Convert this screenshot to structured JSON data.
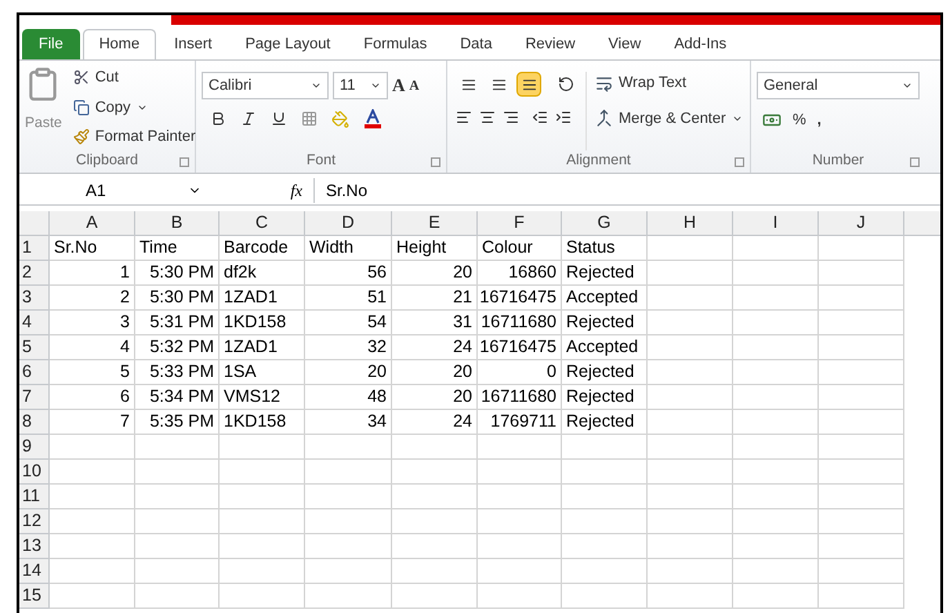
{
  "tabs": [
    {
      "label": "File",
      "kind": "file",
      "selected": false
    },
    {
      "label": "Home",
      "kind": "tab",
      "selected": true
    },
    {
      "label": "Insert",
      "kind": "tab",
      "selected": false
    },
    {
      "label": "Page Layout",
      "kind": "tab",
      "selected": false
    },
    {
      "label": "Formulas",
      "kind": "tab",
      "selected": false
    },
    {
      "label": "Data",
      "kind": "tab",
      "selected": false
    },
    {
      "label": "Review",
      "kind": "tab",
      "selected": false
    },
    {
      "label": "View",
      "kind": "tab",
      "selected": false
    },
    {
      "label": "Add-Ins",
      "kind": "tab",
      "selected": false
    }
  ],
  "clipboard": {
    "paste": "Paste",
    "cut": "Cut",
    "copy": "Copy",
    "format_painter": "Format Painter",
    "label": "Clipboard"
  },
  "font": {
    "name": "Calibri",
    "size": "11",
    "grow": "A",
    "shrink": "A",
    "label": "Font"
  },
  "alignment": {
    "vertical": [
      {
        "selected": false
      },
      {
        "selected": false
      },
      {
        "selected": true
      }
    ],
    "wrap": "Wrap Text",
    "merge": "Merge & Center",
    "label": "Alignment"
  },
  "number": {
    "format": "General",
    "percent": "%",
    "comma": ",",
    "label": "Number"
  },
  "formula_bar": {
    "name_box": "A1",
    "fx": "fx",
    "value": "Sr.No"
  },
  "sheet": {
    "columns": [
      {
        "label": "A",
        "kind": "number"
      },
      {
        "label": "B",
        "kind": "number"
      },
      {
        "label": "C",
        "kind": "text"
      },
      {
        "label": "D",
        "kind": "number"
      },
      {
        "label": "E",
        "kind": "number"
      },
      {
        "label": "F",
        "kind": "number"
      },
      {
        "label": "G",
        "kind": "text"
      },
      {
        "label": "H",
        "kind": "text"
      },
      {
        "label": "I",
        "kind": "text"
      },
      {
        "label": "J",
        "kind": "text"
      }
    ],
    "header_row": [
      "Sr.No",
      "Time",
      "Barcode",
      "Width",
      "Height",
      "Colour",
      "Status"
    ],
    "rows": [
      [
        "1",
        "5:30 PM",
        "df2k",
        "56",
        "20",
        "16860",
        "Rejected"
      ],
      [
        "2",
        "5:30 PM",
        "1ZAD1",
        "51",
        "21",
        "16716475",
        "Accepted"
      ],
      [
        "3",
        "5:31 PM",
        "1KD158",
        "54",
        "31",
        "16711680",
        "Rejected"
      ],
      [
        "4",
        "5:32 PM",
        "1ZAD1",
        "32",
        "24",
        "16716475",
        "Accepted"
      ],
      [
        "5",
        "5:33 PM",
        "1SA",
        "20",
        "20",
        "0",
        "Rejected"
      ],
      [
        "6",
        "5:34 PM",
        "VMS12",
        "48",
        "20",
        "16711680",
        "Rejected"
      ],
      [
        "7",
        "5:35 PM",
        "1KD158",
        "34",
        "24",
        "1769711",
        "Rejected"
      ]
    ],
    "row_numbers": [
      "1",
      "2",
      "3",
      "4",
      "5",
      "6",
      "7",
      "8",
      "9",
      "10",
      "11",
      "12",
      "13",
      "14",
      "15"
    ]
  }
}
